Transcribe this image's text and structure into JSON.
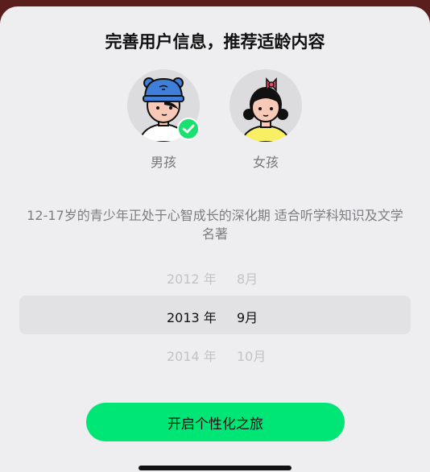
{
  "background": {
    "banner_text": "…"
  },
  "sheet": {
    "title": "完善用户信息，推荐适龄内容",
    "genders": [
      {
        "label": "男孩",
        "selected": true
      },
      {
        "label": "女孩",
        "selected": false
      }
    ],
    "description": "12-17岁的青少年正处于心智成长的深化期 适合听学科知识及文学名著",
    "picker": {
      "rows": [
        {
          "year": "2012 年",
          "month": "8月"
        },
        {
          "year": "2013 年",
          "month": "9月"
        },
        {
          "year": "2014 年",
          "month": "10月"
        }
      ],
      "selected_index": 1
    },
    "cta_label": "开启个性化之旅"
  },
  "colors": {
    "accent": "#00E676",
    "check": "#19E06F",
    "sheet_bg": "#EEEEF0"
  },
  "icons": {
    "selected_badge": "checkmark-icon"
  }
}
